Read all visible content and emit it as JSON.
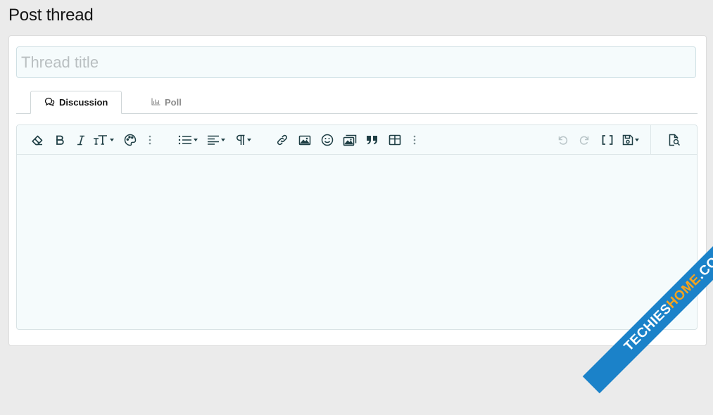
{
  "page": {
    "title": "Post thread"
  },
  "thread_title": {
    "value": "",
    "placeholder": "Thread title"
  },
  "tabs": [
    {
      "label": "Discussion",
      "icon": "comments-icon",
      "active": true
    },
    {
      "label": "Poll",
      "icon": "bar-chart-icon",
      "active": false
    }
  ],
  "toolbar": {
    "left_items": [
      "clear-formatting",
      "bold",
      "italic",
      "text-size",
      "text-color",
      "more-text",
      "list",
      "align",
      "paragraph-format",
      "insert-link",
      "insert-image",
      "insert-smilie",
      "insert-media",
      "quote",
      "insert-table",
      "more-insert"
    ],
    "right_items": [
      "undo",
      "redo",
      "toggle-bbcode",
      "drafts",
      "preview"
    ]
  },
  "editor": {
    "content": ""
  },
  "colors": {
    "accent": "#1f3f45",
    "watermark_blue": "#1b82c9",
    "watermark_orange": "#f7a31c"
  },
  "watermark": {
    "text_a": "TECHIES",
    "text_b": "HOME",
    "text_c": ".COM"
  }
}
